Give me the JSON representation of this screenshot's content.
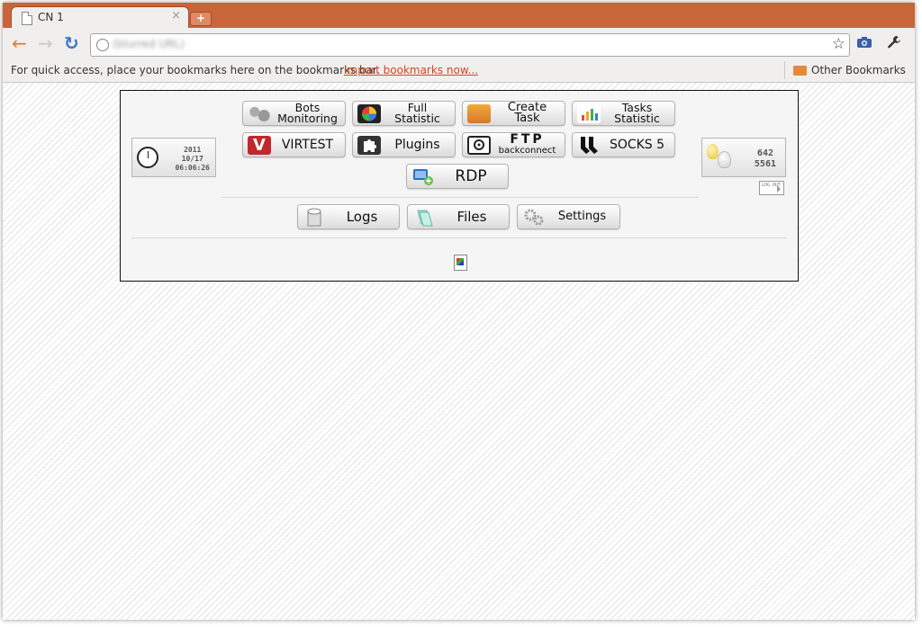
{
  "browser": {
    "tab_title": "CN 1",
    "tab_close": "×",
    "new_tab": "+",
    "url": "(blurred URL)",
    "back": "←",
    "forward": "→",
    "reload": "↻",
    "star": "☆",
    "wrench": "🔧"
  },
  "bookmarks_bar": {
    "text": "For quick access, place your bookmarks here on the bookmarks bar.",
    "import_link": "Import bookmarks now...",
    "other": "Other Bookmarks"
  },
  "panel": {
    "clock": {
      "year": "2011",
      "date": "10/17",
      "time": "06:06:26"
    },
    "counts": {
      "online": "642",
      "total": "5561"
    },
    "logout_label": "LOG OUT",
    "buttons": {
      "bots_monitoring": {
        "line1": "Bots",
        "line2": "Monitoring"
      },
      "full_statistic": {
        "line1": "Full",
        "line2": "Statistic"
      },
      "create_task": "Create Task",
      "tasks_statistic": {
        "line1": "Tasks",
        "line2": "Statistic"
      },
      "virtest": "VIRTEST",
      "plugins": "Plugins",
      "ftp": {
        "line1": "FTP",
        "line2": "backconnect"
      },
      "socks5": "SOCKS 5",
      "rdp": "RDP",
      "logs": "Logs",
      "files": "Files",
      "settings": "Settings"
    }
  },
  "colors": {
    "titlebar": "#c8653a",
    "accent_link": "#d3461c"
  }
}
